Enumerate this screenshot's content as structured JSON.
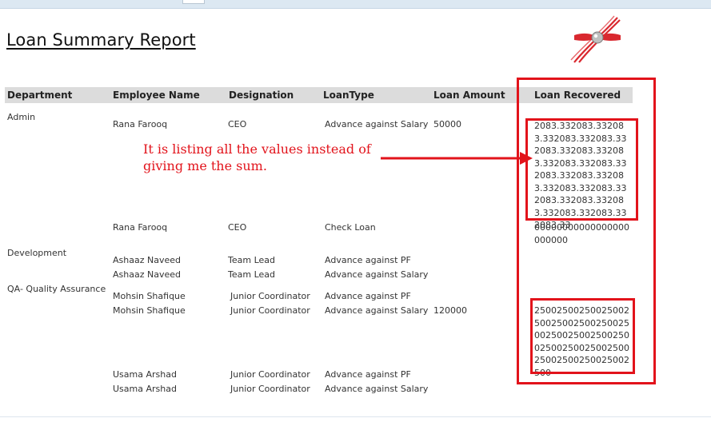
{
  "report": {
    "title": "Loan Summary Report"
  },
  "logo": {
    "icon": "red-swoosh-logo-icon",
    "colors": [
      "#d9282f",
      "#8a8a8a"
    ]
  },
  "columns": [
    "Department",
    "Employee Name",
    "Designation",
    "LoanType",
    "Loan Amount",
    "Loan Recovered"
  ],
  "departments": [
    "Admin",
    "Development",
    "QA- Quality Assurance"
  ],
  "rows": [
    {
      "name": "Rana Farooq",
      "designation": "CEO",
      "loan_type": "Advance against Salary",
      "amount": "50000",
      "recovered": "2083.332083.332083.332083.332083.332083.332083.332083.332083.332083.332083.332083.332083.332083.332083.332083.332083.332083.332083.332083.332083.33"
    },
    {
      "name": "Rana Farooq",
      "designation": "CEO",
      "loan_type": "Check Loan",
      "amount": "",
      "recovered": "00000000000000000000000"
    },
    {
      "name": "Ashaaz  Naveed",
      "designation": "Team Lead",
      "loan_type": "Advance against PF",
      "amount": "",
      "recovered": ""
    },
    {
      "name": "Ashaaz  Naveed",
      "designation": "Team Lead",
      "loan_type": "Advance against Salary",
      "amount": "",
      "recovered": ""
    },
    {
      "name": "Mohsin  Shafique",
      "designation": "Junior Coordinator",
      "loan_type": "Advance against PF",
      "amount": "",
      "recovered": ""
    },
    {
      "name": "Mohsin  Shafique",
      "designation": "Junior Coordinator",
      "loan_type": "Advance against Salary",
      "amount": "120000",
      "recovered": "2500250025002500250025002500250025002500250025002500250025002500250025002500250025002500"
    },
    {
      "name": "Usama Arshad",
      "designation": "Junior Coordinator",
      "loan_type": "Advance against PF",
      "amount": "",
      "recovered": ""
    },
    {
      "name": "Usama Arshad",
      "designation": "Junior Coordinator",
      "loan_type": "Advance against Salary",
      "amount": "",
      "recovered": ""
    }
  ],
  "annotation": {
    "text": "It is listing all the values instead of giving me the sum.",
    "color": "#e2131b"
  },
  "colors": {
    "header_band": "#dcdcdc",
    "topbar": "#dce8f2",
    "highlight": "#e2131b"
  }
}
